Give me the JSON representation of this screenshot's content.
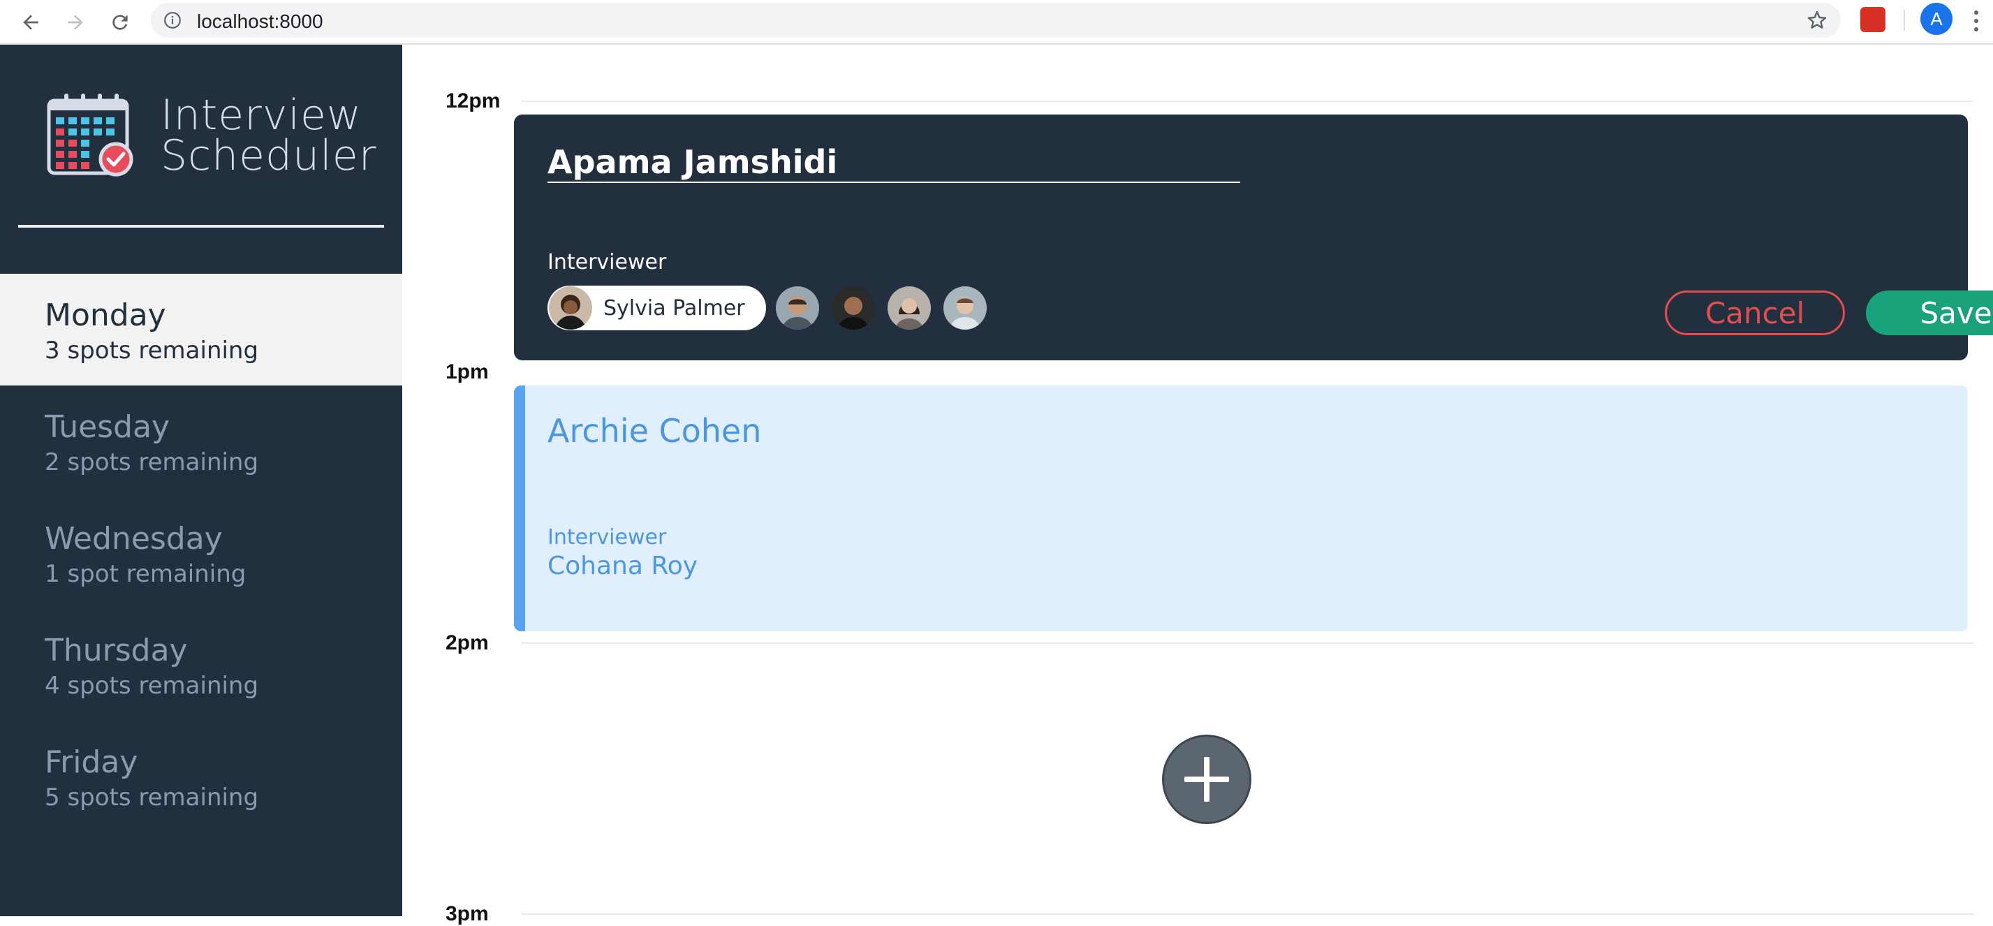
{
  "browser": {
    "url": "localhost:8000",
    "profile_initial": "A",
    "icons": [
      "back-icon",
      "forward-icon",
      "reload-icon",
      "info-icon",
      "star-icon",
      "extension-icon",
      "kebab-menu-icon"
    ]
  },
  "sidebar": {
    "brand_line1": "Interview",
    "brand_line2": "Scheduler",
    "days": [
      {
        "name": "Monday",
        "spots": "3 spots remaining",
        "selected": true
      },
      {
        "name": "Tuesday",
        "spots": "2 spots remaining",
        "selected": false
      },
      {
        "name": "Wednesday",
        "spots": "1 spot remaining",
        "selected": false
      },
      {
        "name": "Thursday",
        "spots": "4 spots remaining",
        "selected": false
      },
      {
        "name": "Friday",
        "spots": "5 spots remaining",
        "selected": false
      }
    ]
  },
  "schedule": {
    "hours": [
      "12pm",
      "1pm",
      "2pm",
      "3pm"
    ],
    "form": {
      "student_name": "Apama Jamshidi",
      "interviewer_label": "Interviewer",
      "selected_interviewer": "Sylvia Palmer",
      "cancel_label": "Cancel",
      "save_label": "Save"
    },
    "appointment": {
      "student": "Archie Cohen",
      "interviewer_label": "Interviewer",
      "interviewer": "Cohana Roy"
    }
  },
  "colors": {
    "sidebar_bg": "#222f3e",
    "selected_day_bg": "#f2f2f2",
    "save_green": "#1aa37a",
    "cancel_red": "#e24d4d",
    "appointment_bg": "#e1effd",
    "appointment_accent": "#5ba3ee"
  }
}
